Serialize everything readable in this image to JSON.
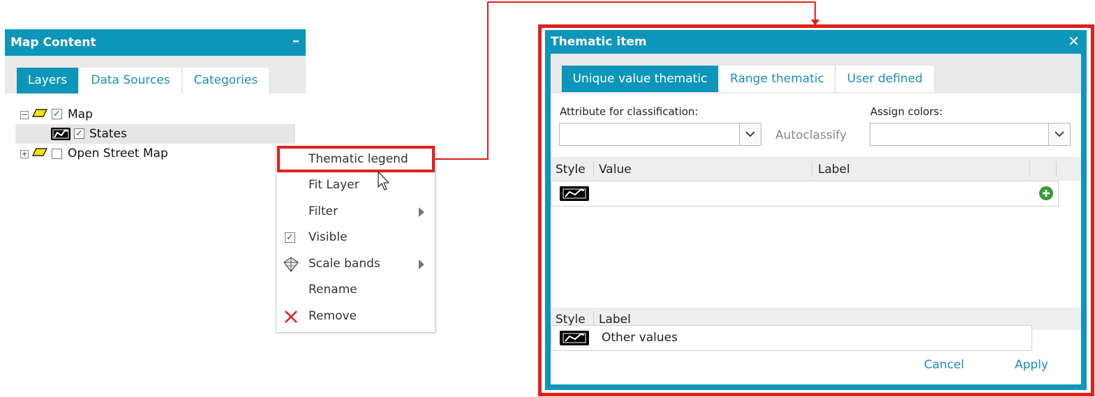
{
  "map_content": {
    "title": "Map Content",
    "minimize_glyph": "–",
    "tabs": [
      {
        "label": "Layers",
        "active": true
      },
      {
        "label": "Data Sources",
        "active": false
      },
      {
        "label": "Categories",
        "active": false
      }
    ],
    "tree": [
      {
        "label": "Map",
        "expander": "−",
        "checked": true
      },
      {
        "label": "States",
        "checked": true,
        "selected": true
      },
      {
        "label": "Open Street Map",
        "expander": "+",
        "checked": false
      }
    ]
  },
  "context_menu": {
    "items": [
      {
        "label": "Thematic legend",
        "highlighted": true
      },
      {
        "label": "Fit Layer"
      },
      {
        "label": "Filter",
        "submenu": true
      },
      {
        "label": "Visible",
        "checked": true
      },
      {
        "label": "Scale bands",
        "submenu": true,
        "icon": "scale-bands-icon"
      },
      {
        "label": "Rename"
      },
      {
        "label": "Remove",
        "icon": "remove-x-icon"
      }
    ]
  },
  "thematic_dialog": {
    "title": "Thematic item",
    "close_glyph": "✕",
    "tabs": [
      {
        "label": "Unique value thematic",
        "active": true
      },
      {
        "label": "Range thematic",
        "active": false
      },
      {
        "label": "User defined",
        "active": false
      }
    ],
    "attribute_label": "Attribute for classification:",
    "attribute_value": "",
    "autoclassify_label": "Autoclassify",
    "assign_colors_label": "Assign colors:",
    "assign_colors_value": "",
    "value_grid": {
      "headers": [
        "Style",
        "Value",
        "Label"
      ]
    },
    "other_grid": {
      "headers": [
        "Style",
        "Label"
      ],
      "rows": [
        {
          "label": "Other values"
        }
      ]
    },
    "cancel_label": "Cancel",
    "apply_label": "Apply"
  },
  "colors": {
    "accent": "#0e96ba",
    "highlight_red": "#e0201c",
    "add_green": "#3a9b3a"
  }
}
